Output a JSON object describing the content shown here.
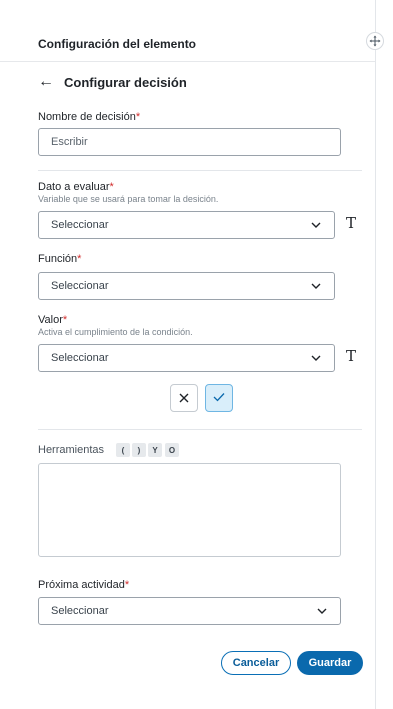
{
  "header": {
    "title": "Configuración del elemento"
  },
  "page": {
    "back_icon": "arrow-left-icon",
    "title": "Configurar decisión"
  },
  "decision_name": {
    "label": "Nombre de decisión",
    "required": "*",
    "placeholder": "Escribir",
    "value": ""
  },
  "data_to_evaluate": {
    "label": "Dato a evaluar",
    "required": "*",
    "hint": "Variable que se usará para tomar la desición.",
    "selected": "Seleccionar",
    "side_icon": "T"
  },
  "function": {
    "label": "Función",
    "required": "*",
    "selected": "Seleccionar"
  },
  "value": {
    "label": "Valor",
    "required": "*",
    "hint": "Activa el cumplimiento de la condición.",
    "selected": "Seleccionar",
    "side_icon": "T"
  },
  "condition_buttons": {
    "reject_icon": "×",
    "accept_icon": "✓"
  },
  "tools": {
    "label": "Herramientas",
    "chips": [
      "(",
      ")",
      "Y",
      "O"
    ]
  },
  "next_activity": {
    "label": "Próxima actividad",
    "required": "*",
    "selected": "Seleccionar"
  },
  "footer": {
    "cancel_label": "Cancelar",
    "save_label": "Guardar"
  },
  "colors": {
    "primary": "#0a69ad",
    "required": "#d12b2b",
    "accept_bg": "#d9eefa"
  }
}
